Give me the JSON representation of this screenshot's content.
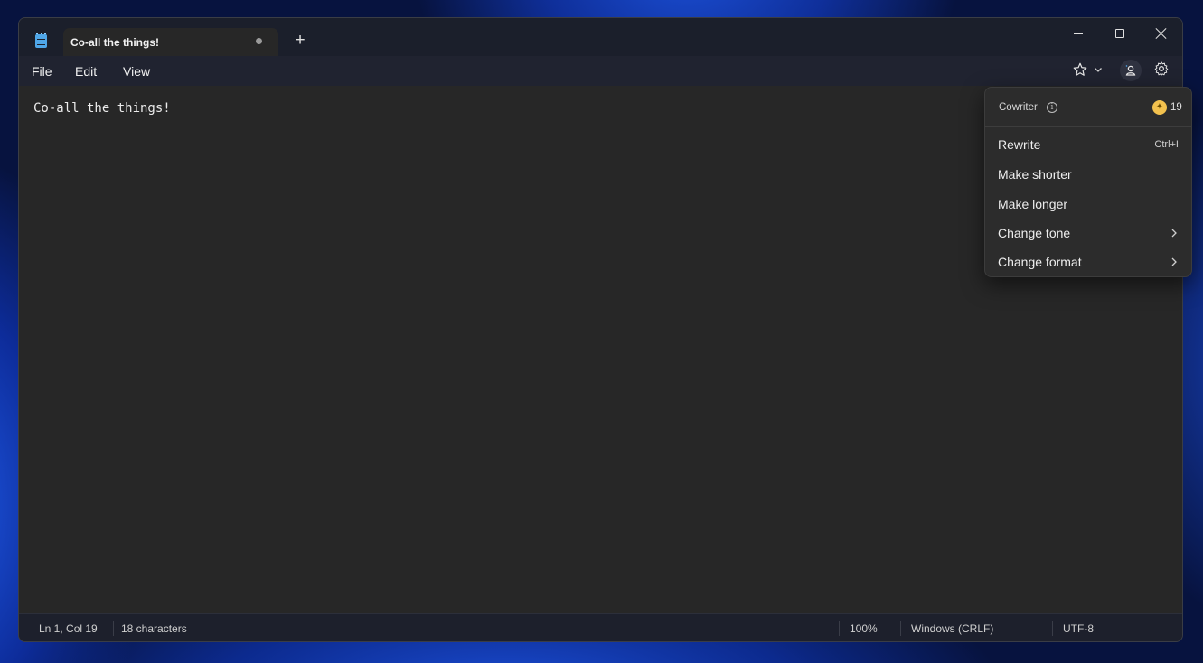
{
  "tab": {
    "title": "Co-all the things!"
  },
  "menu": {
    "file": "File",
    "edit": "Edit",
    "view": "View"
  },
  "editor": {
    "content": "Co-all the things!"
  },
  "status": {
    "position": "Ln 1, Col 19",
    "characters": "18 characters",
    "zoom": "100%",
    "line_ending": "Windows (CRLF)",
    "encoding": "UTF-8"
  },
  "cowriter": {
    "title": "Cowriter",
    "credits": "19",
    "items": [
      {
        "label": "Rewrite",
        "shortcut": "Ctrl+I"
      },
      {
        "label": "Make shorter"
      },
      {
        "label": "Make longer"
      },
      {
        "label": "Change tone"
      },
      {
        "label": "Change format"
      }
    ]
  },
  "icons": [
    "notepad-icon",
    "unsaved-dot-icon",
    "plus-icon",
    "minimize-icon",
    "maximize-icon",
    "close-icon",
    "star-icon",
    "chevron-down-icon",
    "cowriter-icon",
    "gear-icon",
    "info-icon",
    "credit-icon",
    "chevron-right-icon"
  ],
  "colors": {
    "accent": "#4fa6e8",
    "credit": "#f2c14e",
    "editor_bg": "#272727"
  }
}
